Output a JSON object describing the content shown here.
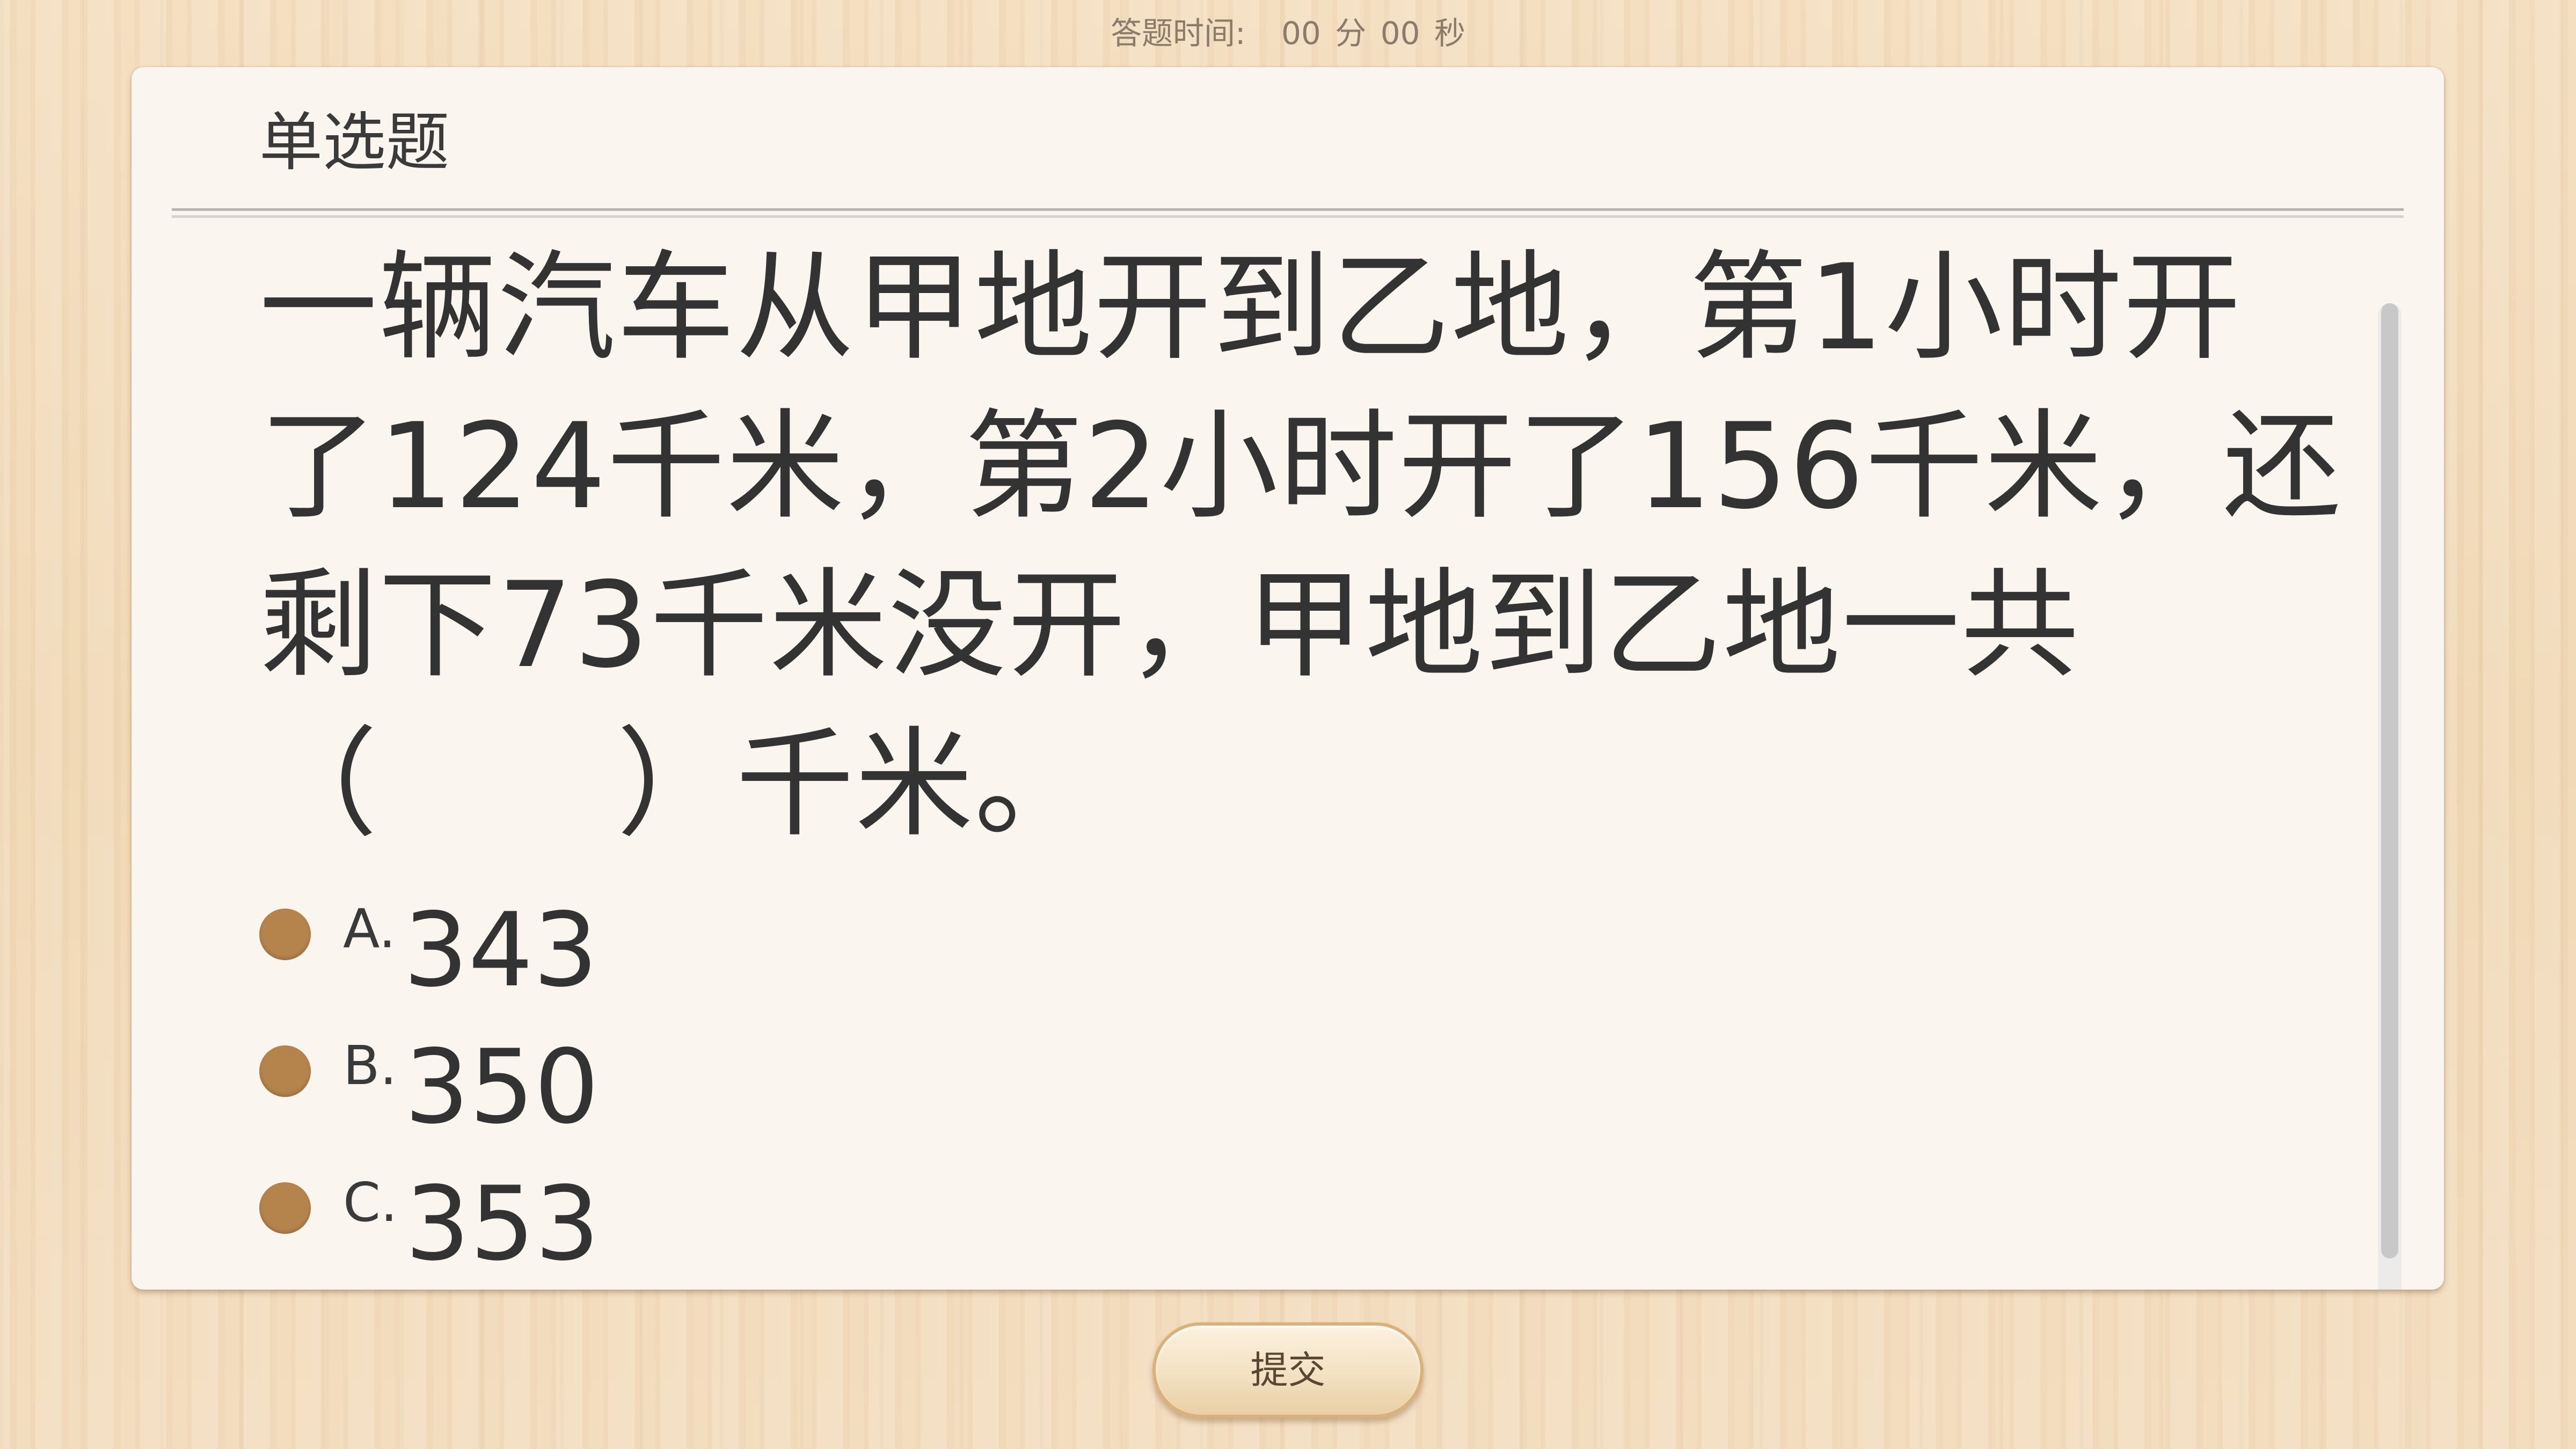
{
  "header": {
    "timer_label": "答题时间:",
    "minutes": "00",
    "minutes_unit": "分",
    "seconds": "00",
    "seconds_unit": "秒"
  },
  "question": {
    "type": "单选题",
    "text": "一辆汽车从甲地开到乙地，第1小时开了124千米，第2小时开了156千米，还剩下73千米没开，甲地到乙地一共（　　）千米。",
    "options": [
      {
        "letter": "A.",
        "value": "343"
      },
      {
        "letter": "B.",
        "value": "350"
      },
      {
        "letter": "C.",
        "value": "353"
      }
    ]
  },
  "footer": {
    "submit_label": "提交"
  },
  "colors": {
    "radio": "#b5834c",
    "card_background": "#faf5ee",
    "text": "#333333"
  }
}
